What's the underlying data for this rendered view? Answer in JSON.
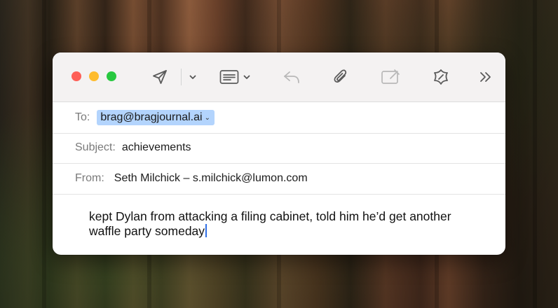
{
  "toolbar": {
    "icons": [
      "send-icon",
      "chevron-down-icon",
      "header-fields-icon",
      "reply-icon",
      "attach-icon",
      "photo-browser-icon",
      "writing-tools-icon",
      "overflow-icon"
    ]
  },
  "header": {
    "to_label": "To:",
    "to_value": "brag@bragjournal.ai",
    "subject_label": "Subject:",
    "subject_value": "achievements",
    "from_label": "From:",
    "from_value": "Seth Milchick – s.milchick@lumon.com"
  },
  "body": {
    "text": "kept Dylan from attacking a filing cabinet, told him he’d get another waffle party someday"
  },
  "colors": {
    "accent_selection": "#b3d4fd",
    "caret": "#2f6fe6",
    "close": "#fe5f57",
    "minimize": "#febc2e",
    "zoom": "#28c840"
  }
}
